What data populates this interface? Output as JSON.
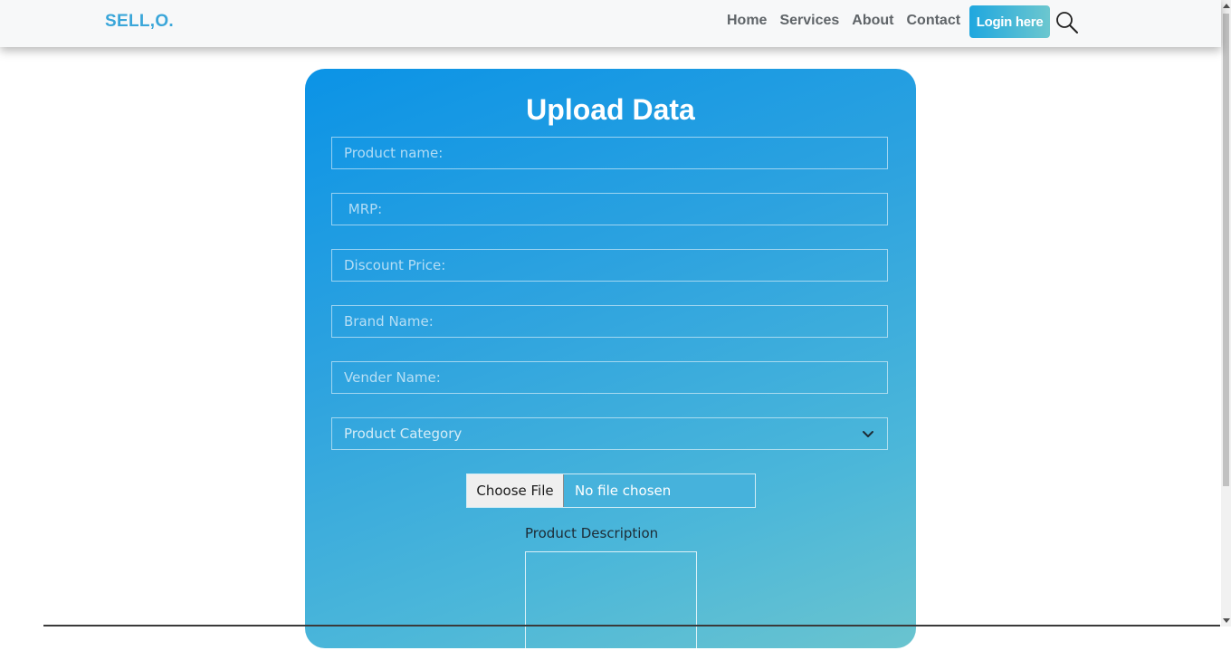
{
  "navbar": {
    "brand": "SELL,O.",
    "links": [
      "Home",
      "Services",
      "About",
      "Contact"
    ],
    "login_label": "Login here",
    "search_icon": "search-icon"
  },
  "form": {
    "title": "Upload Data",
    "fields": {
      "product_name": "Product name:",
      "mrp": " MRP:",
      "discount_price": "Discount Price:",
      "brand_name": "Brand Name:",
      "vender_name": "Vender Name:"
    },
    "category_select": "Product Category",
    "file_button": "Choose File",
    "file_status": "No file chosen",
    "description_label": "Product Description"
  },
  "colors": {
    "brand": "#3aa6d9",
    "card_gradient_start": "#0b93e6",
    "card_gradient_end": "#6ac4cf",
    "nav_text": "#5f6468"
  }
}
